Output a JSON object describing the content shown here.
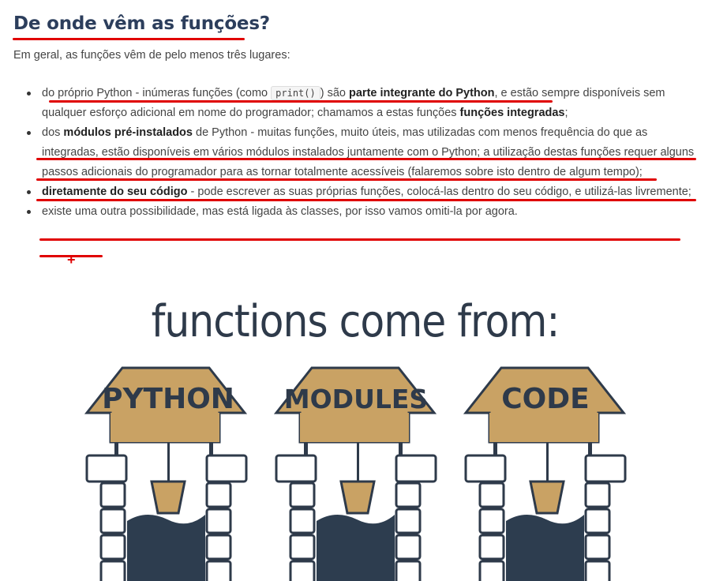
{
  "heading": "De onde vêm as funções?",
  "intro": "Em geral, as funções vêm de pelo menos três lugares:",
  "items": [
    {
      "t1": "do próprio Python - inúmeras funções (como ",
      "code": "print()",
      "t2": ") são ",
      "b1": "parte integrante do Python",
      "t3": ", e estão sempre disponíveis sem qualquer esforço adicional em nome do programador; chamamos a estas funções ",
      "b2": "funções integradas",
      "t4": ";"
    },
    {
      "t1": "dos ",
      "b1": "módulos pré-instalados",
      "t2": " de Python - muitas funções, muito úteis, mas utilizadas com menos frequência do que as integradas, estão disponíveis em vários módulos instalados juntamente com o Python; a utilização destas funções requer alguns passos adicionais do programador para as tornar totalmente acessíveis (falaremos sobre isto dentro de algum tempo);"
    },
    {
      "b1": "diretamente do seu código",
      "t1": " - pode escrever as suas próprias funções, colocá-las dentro do seu código, e utilizá-las livremente;"
    },
    {
      "t1": "existe uma outra possibilidade, mas está ligada às classes, por isso vamos omiti-la por agora."
    }
  ],
  "figure": {
    "title": "functions come from:",
    "wells": [
      "PYTHON",
      "MODULES",
      "CODE"
    ]
  },
  "colors": {
    "heading": "#2c3e5c",
    "annotation": "#e00000",
    "roof": "#c9a264",
    "ink": "#2e3a4a",
    "water": "#2d3d4f"
  },
  "icons": [
    "cursor-crosshair-icon"
  ]
}
